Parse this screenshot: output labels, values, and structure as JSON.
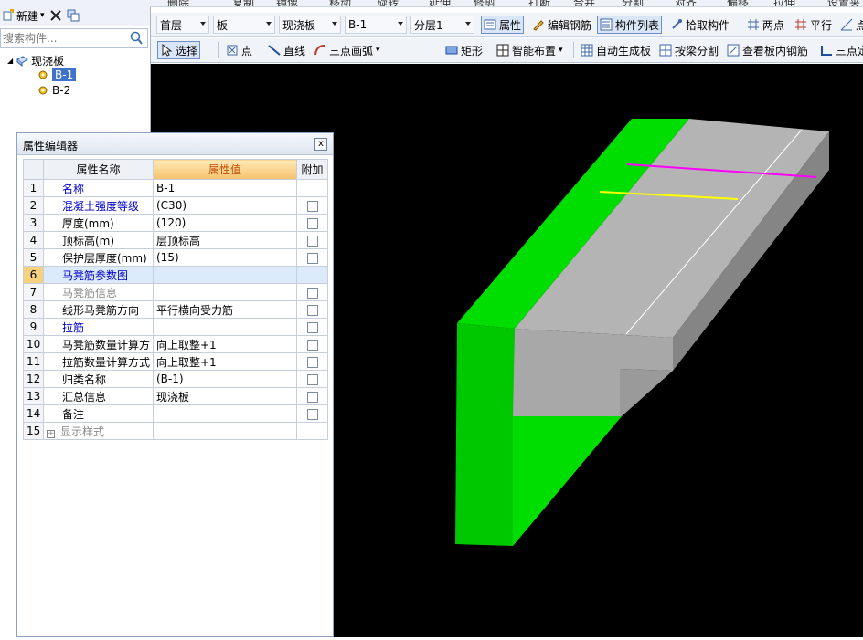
{
  "top_strip": [
    "删除",
    "复制",
    "镜像",
    "移动",
    "旋转",
    "延伸",
    "修剪",
    "打断",
    "合并",
    "分割",
    "对齐",
    "偏移",
    "拉伸",
    "设置夹点"
  ],
  "left_toolbar": {
    "new_label": "新建",
    "new_arrow": "▾"
  },
  "search": {
    "placeholder": "搜索构件..."
  },
  "tree": {
    "root": "现浇板",
    "items": [
      "B-1",
      "B-2"
    ]
  },
  "toolbar1": {
    "floor": "首层",
    "type": "板",
    "subtype": "现浇板",
    "component": "B-1",
    "layer": "分层1",
    "buttons": [
      "属性",
      "编辑钢筋",
      "构件列表",
      "拾取构件",
      "两点",
      "平行",
      "点角"
    ]
  },
  "toolbar2": {
    "buttons": [
      "选择",
      "点",
      "直线",
      "三点画弧",
      "矩形",
      "智能布置",
      "自动生成板",
      "按梁分割",
      "查看板内钢筋",
      "三点定义斜板"
    ]
  },
  "property_editor": {
    "title": "属性编辑器",
    "close_label": "x",
    "headers": [
      "属性名称",
      "属性值",
      "附加"
    ],
    "rows": [
      {
        "no": "1",
        "name": "名称",
        "value": "B-1",
        "style": "blue",
        "check": false
      },
      {
        "no": "2",
        "name": "混凝土强度等级",
        "value": "(C30)",
        "style": "blue",
        "check": true
      },
      {
        "no": "3",
        "name": "厚度(mm)",
        "value": "(120)",
        "style": "",
        "check": true
      },
      {
        "no": "4",
        "name": "顶标高(m)",
        "value": "层顶标高",
        "style": "",
        "check": true
      },
      {
        "no": "5",
        "name": "保护层厚度(mm)",
        "value": "(15)",
        "style": "",
        "check": true
      },
      {
        "no": "6",
        "name": "马凳筋参数图",
        "value": "",
        "style": "blue",
        "check": false
      },
      {
        "no": "7",
        "name": "马凳筋信息",
        "value": "",
        "style": "gray",
        "check": true
      },
      {
        "no": "8",
        "name": "线形马凳筋方向",
        "value": "平行横向受力筋",
        "style": "",
        "check": true
      },
      {
        "no": "9",
        "name": "拉筋",
        "value": "",
        "style": "blue",
        "check": true
      },
      {
        "no": "10",
        "name": "马凳筋数量计算方",
        "value": "向上取整+1",
        "style": "",
        "check": true
      },
      {
        "no": "11",
        "name": "拉筋数量计算方式",
        "value": "向上取整+1",
        "style": "",
        "check": true
      },
      {
        "no": "12",
        "name": "归类名称",
        "value": "(B-1)",
        "style": "",
        "check": true
      },
      {
        "no": "13",
        "name": "汇总信息",
        "value": "现浇板",
        "style": "",
        "check": true
      },
      {
        "no": "14",
        "name": "备注",
        "value": "",
        "style": "",
        "check": true
      },
      {
        "no": "15",
        "name": "显示样式",
        "value": "",
        "style": "gray",
        "check": false
      }
    ]
  },
  "colors": {
    "viewport_bg": "#000000",
    "beam_green": "#00dd00",
    "slab_gray": "#b4b4b4",
    "rebar_magenta": "#ff00ff",
    "rebar_yellow": "#ffff00"
  }
}
